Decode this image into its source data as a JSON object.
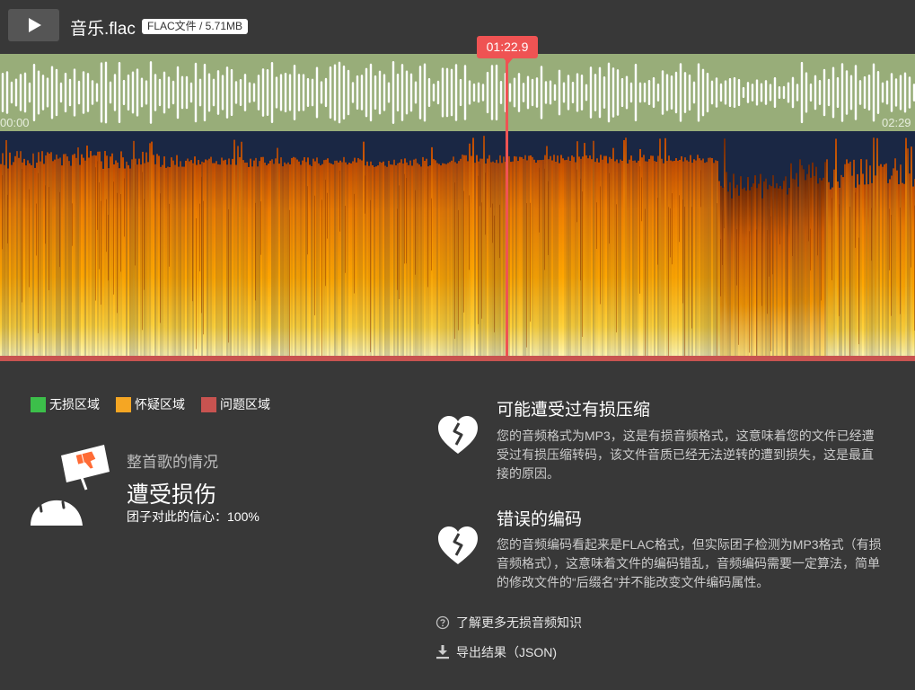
{
  "player": {
    "play_icon": "play-icon",
    "file_name": "音乐.flac",
    "file_badge": "FLAC文件 / 5.71MB",
    "playhead_time": "01:22.9",
    "time_start": "00:00",
    "time_end": "02:29",
    "playback_progress": 0.553
  },
  "colors": {
    "waveform_bg": "#98ad79",
    "playhead": "#ef5353",
    "lossless": "#3cbf4a",
    "suspicious": "#f5a623",
    "problem": "#c85350",
    "spectrogram_dark": "#1a2744",
    "spectrogram_hot": "#ffb000"
  },
  "legend": [
    {
      "label": "无损区域",
      "color": "#3cbf4a"
    },
    {
      "label": "怀疑区域",
      "color": "#f5a623"
    },
    {
      "label": "问题区域",
      "color": "#c85350"
    }
  ],
  "verdict": {
    "illustration_icon": "sad-face-thumbs-down-sign-icon",
    "subtitle": "整首歌的情况",
    "title": "遭受损伤",
    "confidence": "团子对此的信心：100%"
  },
  "issues": [
    {
      "icon": "broken-heart-icon",
      "title": "可能遭受过有损压缩",
      "description": "您的音频格式为MP3，这是有损音频格式，这意味着您的文件已经遭受过有损压缩转码，该文件音质已经无法逆转的遭到损失，这是最直接的原因。"
    },
    {
      "icon": "broken-heart-icon",
      "title": "错误的编码",
      "description": "您的音频编码看起来是FLAC格式，但实际团子检测为MP3格式（有损音频格式），这意味着文件的编码错乱，音频编码需要一定算法，简单的修改文件的“后缀名”并不能改变文件编码属性。"
    }
  ],
  "links": {
    "learn_more_icon": "help-circle-icon",
    "learn_more": "了解更多无损音频知识",
    "export_icon": "download-icon",
    "export": "导出结果（JSON)"
  }
}
